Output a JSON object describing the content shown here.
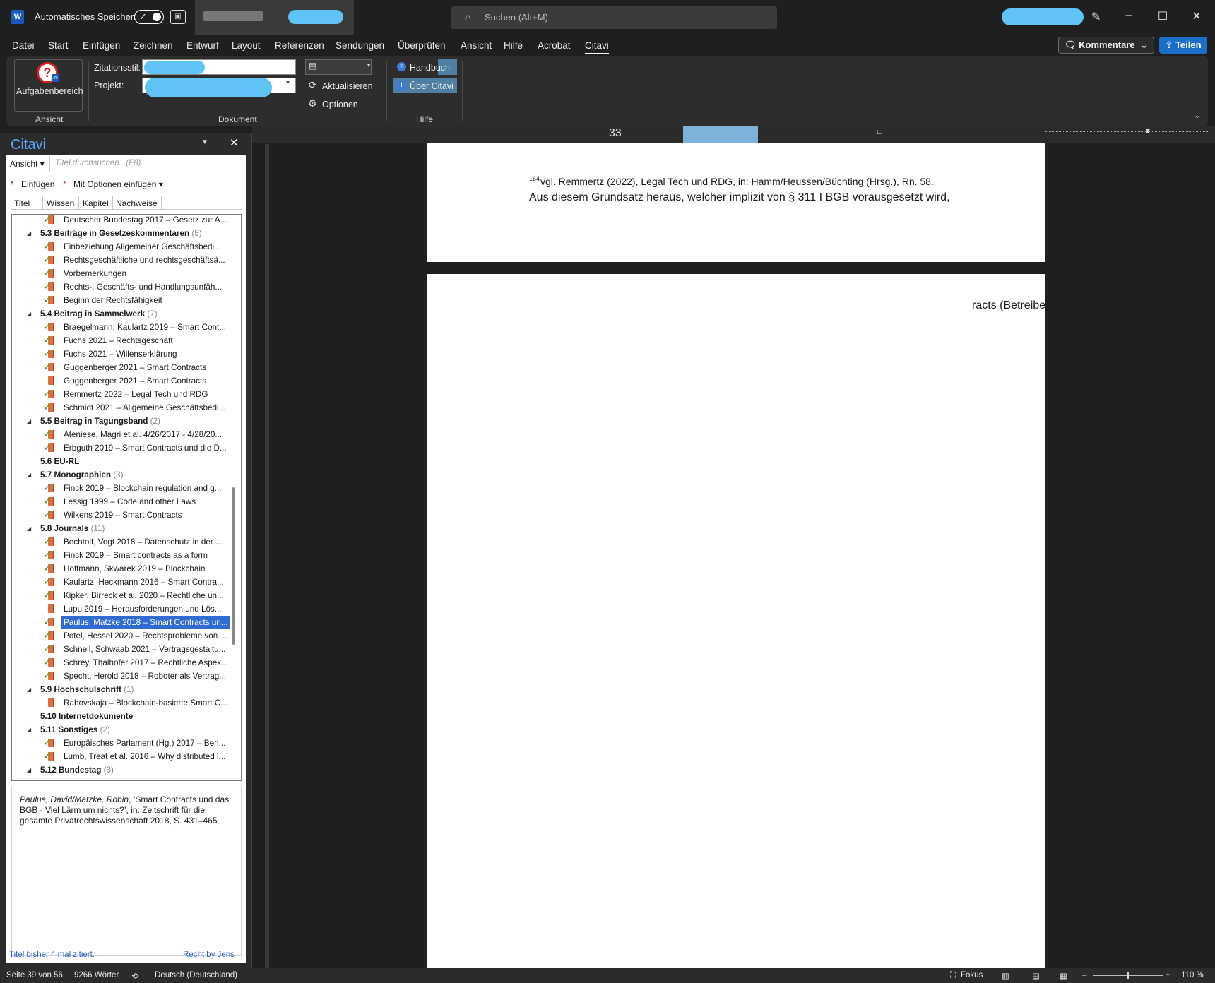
{
  "titlebar": {
    "app_icon": "W",
    "autosave_label": "Automatisches Speichern",
    "search_placeholder": "Suchen (Alt+M)"
  },
  "menu": [
    "Datei",
    "Start",
    "Einfügen",
    "Zeichnen",
    "Entwurf",
    "Layout",
    "Referenzen",
    "Sendungen",
    "Überprüfen",
    "Ansicht",
    "Hilfe",
    "Acrobat",
    "Citavi"
  ],
  "menu_active": "Citavi",
  "comments_button": "Kommentare",
  "share_button": "Teilen",
  "ribbon": {
    "taskpane_button": "Aufgabenbereich",
    "group_ansicht": "Ansicht",
    "zitationsstil_label": "Zitationsstil:",
    "projekt_label": "Projekt:",
    "update_label": "Aktualisieren",
    "options_label": "Optionen",
    "group_dokument": "Dokument",
    "manual_label": "Handbuch",
    "about_label": "Über Citavi",
    "group_hilfe": "Hilfe"
  },
  "pane": {
    "title": "Citavi",
    "view_dropdown": "Ansicht",
    "search_placeholder": "Titel durchsuchen...(F8)",
    "insert_button": "Einfügen",
    "insert_options_button": "Mit Optionen einfügen",
    "tabs": [
      "Titel",
      "Wissen",
      "Kapitel",
      "Nachweise"
    ],
    "footer_left": "Titel bisher 4 mal zitiert.",
    "footer_right": "Recht by Jens"
  },
  "tree": [
    {
      "type": "item",
      "label": "Deutscher Bundestag 2017 – Gesetz zur A...",
      "checked": true
    },
    {
      "type": "heading",
      "label": "5.3 Beiträge in Gesetzeskommentaren",
      "count": "(5)"
    },
    {
      "type": "item",
      "label": "Einbeziehung Allgemeiner Geschäftsbedi...",
      "checked": true
    },
    {
      "type": "item",
      "label": "Rechtsgeschäftliche und rechtsgeschäftsä...",
      "checked": true
    },
    {
      "type": "item",
      "label": "Vorbemerkungen",
      "checked": true
    },
    {
      "type": "item",
      "label": "Rechts-, Geschäfts- und Handlungsunfäh...",
      "checked": true
    },
    {
      "type": "item",
      "label": "Beginn der Rechtsfähigkeit",
      "checked": true
    },
    {
      "type": "heading",
      "label": "5.4 Beitrag in Sammelwerk",
      "count": "(7)"
    },
    {
      "type": "item",
      "label": "Braegelmann, Kaulartz 2019 – Smart Cont...",
      "checked": true
    },
    {
      "type": "item",
      "label": "Fuchs 2021 – Rechtsgeschäft",
      "checked": true
    },
    {
      "type": "item",
      "label": "Fuchs 2021 – Willenserklärung",
      "checked": true
    },
    {
      "type": "item",
      "label": "Guggenberger 2021 – Smart Contracts",
      "checked": true
    },
    {
      "type": "item",
      "label": "Guggenberger 2021 – Smart Contracts",
      "checked": false
    },
    {
      "type": "item",
      "label": "Remmertz 2022 – Legal Tech und RDG",
      "checked": true
    },
    {
      "type": "item",
      "label": "Schmidt 2021 – Allgemeine Geschäftsbedi...",
      "checked": true
    },
    {
      "type": "heading",
      "label": "5.5 Beitrag in Tagungsband",
      "count": "(2)"
    },
    {
      "type": "item",
      "label": "Ateniese, Magri et al. 4/26/2017 - 4/28/20...",
      "checked": true
    },
    {
      "type": "item",
      "label": "Erbguth 2019 – Smart Contracts und die D...",
      "checked": true
    },
    {
      "type": "heading",
      "label": "5.6 EU-RL",
      "count": "",
      "noarrow": true
    },
    {
      "type": "heading",
      "label": "5.7 Monographien",
      "count": "(3)"
    },
    {
      "type": "item",
      "label": "Finck 2019 – Blockchain regulation and g...",
      "checked": true
    },
    {
      "type": "item",
      "label": "Lessig 1999 – Code and other Laws",
      "checked": true
    },
    {
      "type": "item",
      "label": "Wilkens 2019 – Smart Contracts",
      "checked": true
    },
    {
      "type": "heading",
      "label": "5.8 Journals",
      "count": "(11)"
    },
    {
      "type": "item",
      "label": "Bechtolf, Vogt 2018 – Datenschutz in der ...",
      "checked": true
    },
    {
      "type": "item",
      "label": "Finck 2019 – Smart contracts as a form",
      "checked": true
    },
    {
      "type": "item",
      "label": "Hoffmann, Skwarek 2019 – Blockchain",
      "checked": true
    },
    {
      "type": "item",
      "label": "Kaulartz, Heckmann 2016 – Smart Contra...",
      "checked": true
    },
    {
      "type": "item",
      "label": "Kipker, Birreck et al. 2020 – Rechtliche un...",
      "checked": true
    },
    {
      "type": "item",
      "label": "Lupu 2019 – Herausforderungen und Lös...",
      "checked": false
    },
    {
      "type": "item",
      "label": "Paulus, Matzke 2018 – Smart Contracts un...",
      "checked": true,
      "selected": true
    },
    {
      "type": "item",
      "label": "Potel, Hessel 2020 – Rechtsprobleme von ...",
      "checked": true
    },
    {
      "type": "item",
      "label": "Schnell, Schwaab 2021 – Vertragsgestaltu...",
      "checked": true
    },
    {
      "type": "item",
      "label": "Schrey, Thalhofer 2017 – Rechtliche Aspek...",
      "checked": true
    },
    {
      "type": "item",
      "label": "Specht, Herold 2018 – Roboter als Vertrag...",
      "checked": true
    },
    {
      "type": "heading",
      "label": "5.9 Hochschulschrift",
      "count": "(1)"
    },
    {
      "type": "item",
      "label": "Rabovskaja – Blockchain-basierte Smart C...",
      "checked": false
    },
    {
      "type": "heading",
      "label": "5.10 Internetdokumente",
      "count": "",
      "noarrow": true
    },
    {
      "type": "heading",
      "label": "5.11 Sonstiges",
      "count": "(2)"
    },
    {
      "type": "item",
      "label": "Europäisches Parlament (Hg.) 2017 – Beri...",
      "checked": true
    },
    {
      "type": "item",
      "label": "Lumb, Treat et al. 2016 – Why distributed l...",
      "checked": true
    },
    {
      "type": "heading",
      "label": "5.12 Bundestag",
      "count": "(3)"
    }
  ],
  "detail": {
    "authors": "Paulus, David/Matzke, Robin",
    "rest": ", ‘Smart Contracts und das BGB - Viel Lärm um nichts?’, in: Zeitschrift für die gesamte Privatrechtswissenschaft 2018, S. 431–465."
  },
  "document": {
    "ruler_number": "33",
    "footnote": "vgl. Remmertz (2022), Legal Tech und RDG, in: Hamm/Heussen/Büchting (Hrsg.), Rn. 58.",
    "footnote_mark": "164",
    "body_line": "Aus diesem Grundsatz heraus, welcher implizit von § 311 I BGB vorausgesetzt wird,",
    "page2_fragment": "racts (Betreibe"
  },
  "statusbar": {
    "page": "Seite 39 von 56",
    "words": "9266 Wörter",
    "language": "Deutsch (Deutschland)",
    "focus": "Fokus",
    "zoom": "110 %"
  }
}
